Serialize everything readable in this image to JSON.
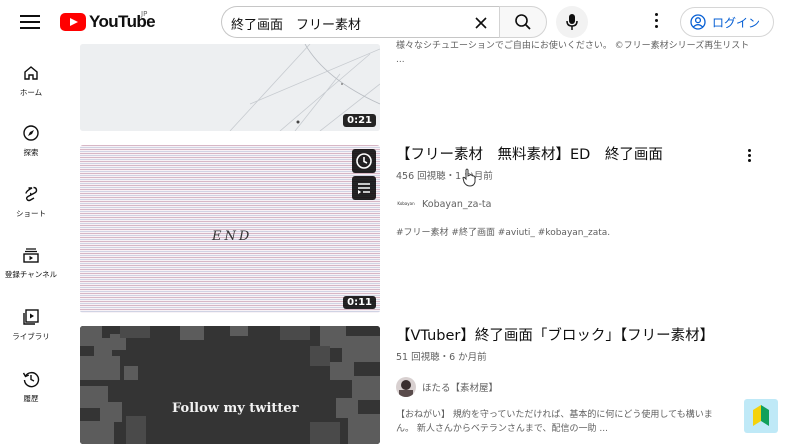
{
  "header": {
    "logo_text": "YouTube",
    "logo_country": "JP",
    "search_value": "終了画面　フリー素材",
    "login_label": "ログイン",
    "icons": [
      "menu-icon",
      "youtube-logo",
      "clear-icon",
      "search-icon",
      "mic-icon",
      "more-vert-icon",
      "account-icon"
    ]
  },
  "sidebar": {
    "items": [
      {
        "label": "ホーム",
        "icon": "home-icon"
      },
      {
        "label": "探索",
        "icon": "explore-icon"
      },
      {
        "label": "ショート",
        "icon": "shorts-icon"
      },
      {
        "label": "登録チャンネル",
        "icon": "subscriptions-icon"
      },
      {
        "label": "ライブラリ",
        "icon": "library-icon"
      },
      {
        "label": "履歴",
        "icon": "history-icon"
      }
    ]
  },
  "results": [
    {
      "duration": "0:21",
      "desc": "様々なシチュエーションでご自由にお使いください。 ©フリー素材シリーズ再生リスト ..."
    },
    {
      "title": "【フリー素材　無料素材】ED　終了画面",
      "meta": "456 回視聴・1 か月前",
      "channel": "Kobayan_za-ta",
      "channel_avatar_text": "Kobayan",
      "desc": "#フリー素材 #終了画面 #aviuti_ #kobayan_zata.",
      "thumb_text": "END",
      "duration": "0:11"
    },
    {
      "title": "【VTuber】終了画面「ブロック」【フリー素材】",
      "meta": "51 回視聴・6 か月前",
      "channel": "ほたる【素材屋】",
      "desc_line1": "【おねがい】 規約を守っていただければ、基本的に何にどう使用しても構いま",
      "desc_line2": "ん。 新人さんからベテランさんまで、配信の一助 ...",
      "thumb_text": "Follow my twitter"
    }
  ],
  "colors": {
    "brand_red": "#ff0000",
    "link_blue": "#065fd4",
    "meta_gray": "#606060"
  }
}
